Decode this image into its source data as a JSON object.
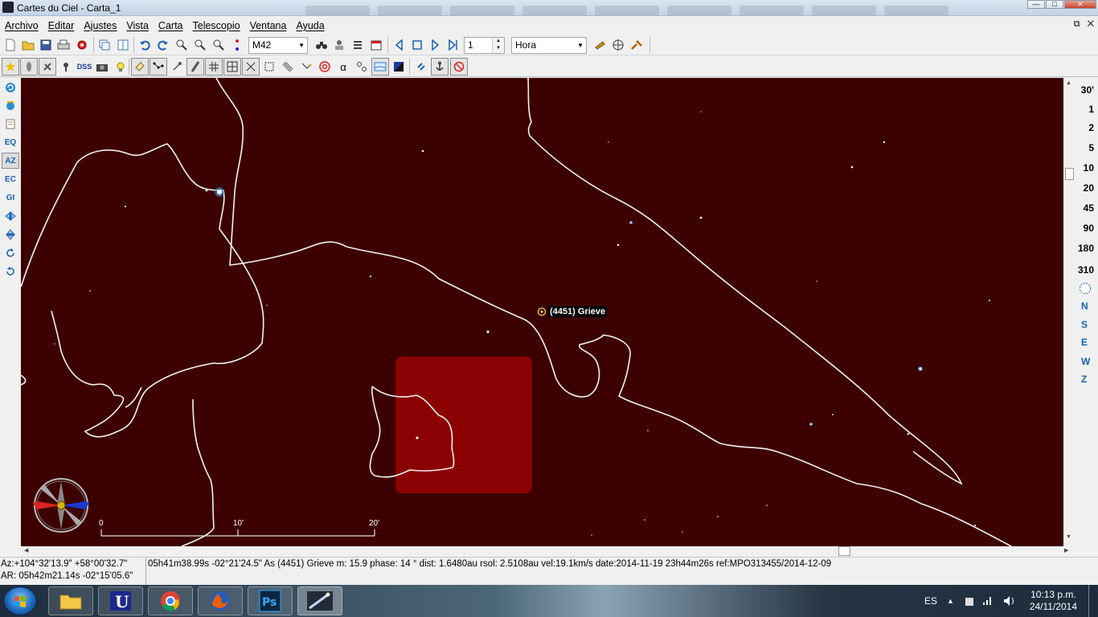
{
  "window": {
    "title": "Cartes du Ciel - Carta_1"
  },
  "menu": [
    "Archivo",
    "Editar",
    "Ajustes",
    "Vista",
    "Carta",
    "Telescopio",
    "Ventana",
    "Ayuda"
  ],
  "toolbar": {
    "search_value": "M42",
    "step_value": "1",
    "time_unit": "Hora"
  },
  "toolbar2": {
    "dss_label": "DSS"
  },
  "left_tools": [
    "EQ",
    "AZ",
    "EC",
    "GI"
  ],
  "fov_levels": [
    "30'",
    "1",
    "2",
    "5",
    "10",
    "20",
    "45",
    "90",
    "180",
    "310"
  ],
  "cardinal_points": [
    "N",
    "S",
    "E",
    "W",
    "Z"
  ],
  "chart": {
    "object_label": "(4451) Grieve",
    "scale_labels": [
      "0",
      "10'",
      "20'"
    ]
  },
  "status": {
    "altaz": "Az:+104°32'13.9\" +58°00'32.7\"",
    "radec": "AR: 05h42m21.14s -02°15'05.6\"",
    "object_info": "05h41m38.99s -02°21'24.5\" As (4451) Grieve m: 15.9 phase: 14 ° dist: 1.6480au rsol: 2.5108au vel:19.1km/s date:2014-11-19 23h44m26s ref:MPO313455/2014-12-09"
  },
  "taskbar": {
    "language": "ES",
    "time": "10:13 p.m.",
    "date": "24/11/2014"
  },
  "colors": {
    "sky_background": "#3d0000",
    "highlight_square": "#8b0000",
    "constellation_lines": "#f2f2f2",
    "accent_blue": "#1a63b0"
  }
}
